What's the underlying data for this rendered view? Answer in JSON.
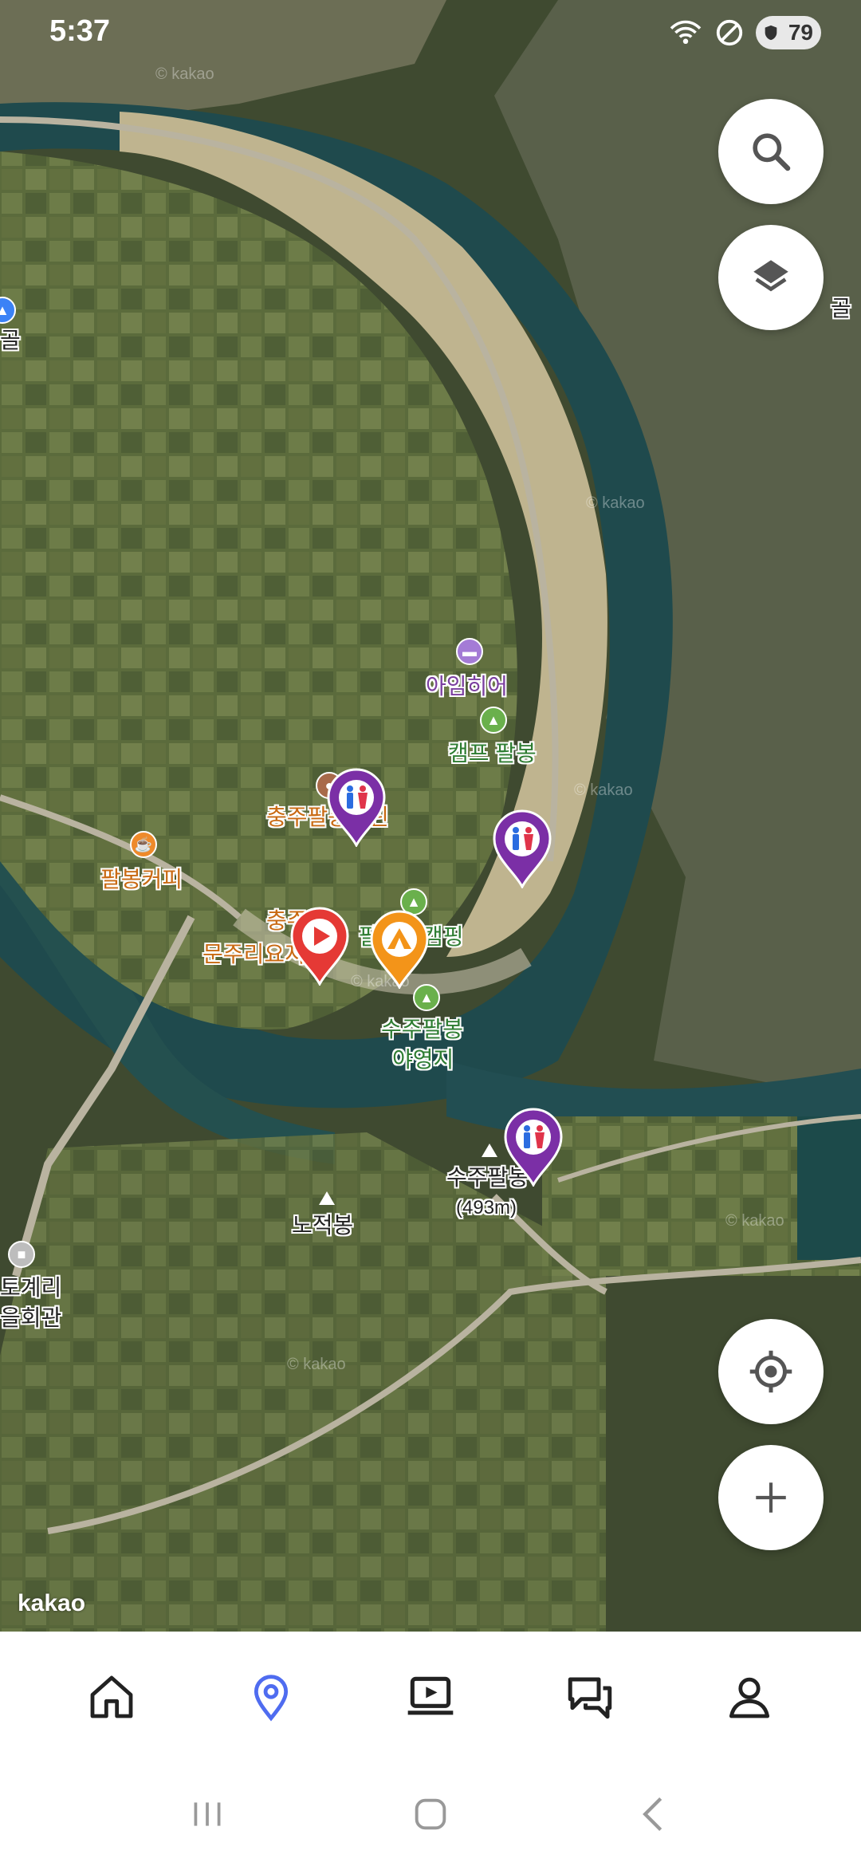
{
  "status_bar": {
    "time": "5:37",
    "battery": "79",
    "icons": [
      "wifi-icon",
      "do-not-disturb-icon",
      "battery-icon"
    ]
  },
  "map": {
    "attribution": "kakao",
    "watermark": "© kakao",
    "labels": {
      "aimhieo": "아임히어",
      "camp_palbong": "캠프 팔봉",
      "chungju_palbong": "충주팔봉",
      "chungju_palbong_suffix": "린",
      "palbong_coffee": "팔봉커피",
      "chungju_2": "충주",
      "munjuri": "문주리요지",
      "palbong_camping_prefix": "팔",
      "palbong_camping_suffix": "캠핑",
      "suju_palbong_campsite_1": "수주팔봉",
      "suju_palbong_campsite_2": "야영지",
      "suju_palbong_peak": "수주팔봉",
      "suju_palbong_elev": "(493m)",
      "nojeokbong": "노적봉",
      "edge_left_1": "골",
      "edge_right_1": "골",
      "togyeri_1": "토계리",
      "togyeri_2": "을회관"
    }
  },
  "buttons": {
    "search": "search-icon",
    "layers": "layers-icon",
    "locate": "locate-icon",
    "zoom_in": "plus-icon"
  },
  "bottom_nav": {
    "items": [
      "home-icon",
      "map-pin-icon",
      "video-icon",
      "chat-icon",
      "profile-icon"
    ],
    "active_index": 1,
    "active_color": "#4f6cf0"
  },
  "system_nav": [
    "recent-apps-icon",
    "home-circle-icon",
    "back-icon"
  ]
}
